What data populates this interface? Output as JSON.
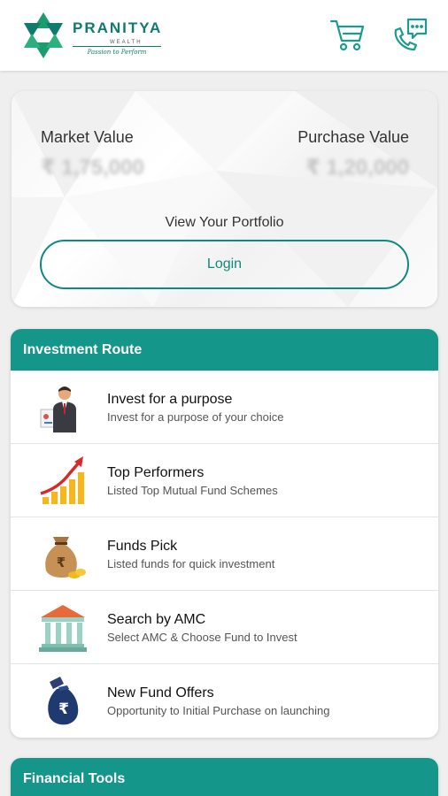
{
  "header": {
    "brand_name": "PRANITYA",
    "brand_sub": "WEALTH",
    "brand_tagline": "Passion to Perform",
    "cart_icon": "cart-icon",
    "chat_icon": "phone-chat-icon"
  },
  "portfolio": {
    "market_value_label": "Market Value",
    "market_value": "₹ 1,75,000",
    "purchase_value_label": "Purchase Value",
    "purchase_value": "₹ 1,20,000",
    "view_link": "View Your Portfolio",
    "login_label": "Login"
  },
  "investment_route": {
    "title": "Investment Route",
    "items": [
      {
        "title": "Invest for a purpose",
        "subtitle": "Invest for a purpose of your choice",
        "icon": "businessman-icon"
      },
      {
        "title": "Top Performers",
        "subtitle": "Listed Top Mutual Fund Schemes",
        "icon": "growth-chart-icon"
      },
      {
        "title": "Funds Pick",
        "subtitle": "Listed funds for quick investment",
        "icon": "money-bag-icon"
      },
      {
        "title": "Search by AMC",
        "subtitle": "Select AMC & Choose Fund to Invest",
        "icon": "bank-building-icon"
      },
      {
        "title": "New Fund Offers",
        "subtitle": "Opportunity to Initial Purchase on launching",
        "icon": "rupee-bag-icon"
      }
    ]
  },
  "financial_tools": {
    "title": "Financial Tools"
  },
  "colors": {
    "brand_teal": "#15968a",
    "button_teal": "#0f8a7e",
    "background": "#efefef"
  }
}
